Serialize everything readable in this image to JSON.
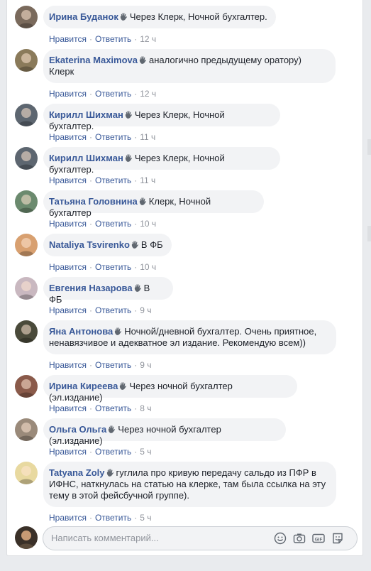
{
  "comments": [
    {
      "author": "Ирина Буданок",
      "text_lines": [
        "Через Клерк, Ночной бухгалтер."
      ],
      "time": "12 ч",
      "avatar_color": "#7a6a5c"
    },
    {
      "author": "Ekaterina Maximova",
      "text_lines": [
        "аналогично предыдущему оратору)",
        "Клерк"
      ],
      "time": "12 ч",
      "avatar_color": "#8a7a5a"
    },
    {
      "author": "Кирилл Шихман",
      "text_lines": [
        "Через Клерк, Ночной бухгалтер."
      ],
      "time": "11 ч",
      "avatar_color": "#5d6670"
    },
    {
      "author": "Кирилл Шихман",
      "text_lines": [
        "Через Клерк, Ночной бухгалтер."
      ],
      "time": "11 ч",
      "avatar_color": "#5d6670"
    },
    {
      "author": "Татьяна Головнина",
      "text_lines": [
        "Клерк, Ночной бухгалтер"
      ],
      "time": "10 ч",
      "avatar_color": "#6b8a6e"
    },
    {
      "author": "Nataliya Tsvirenko",
      "text_lines": [
        "В ФБ"
      ],
      "time": "10 ч",
      "avatar_color": "#d8a070"
    },
    {
      "author": "Евгения Назарова",
      "text_lines": [
        "В ФБ"
      ],
      "time": "9 ч",
      "avatar_color": "#c9b8c0"
    },
    {
      "author": "Яна Антонова",
      "text_lines": [
        "Ночной/дневной бухгалтер. Очень приятное,",
        "ненавязчивое и адекватное эл издание. Рекомендую всем))"
      ],
      "time": "9 ч",
      "avatar_color": "#4a4a3a"
    },
    {
      "author": "Ирина Киреева",
      "text_lines": [
        "Через ночной бухгалтер (эл.издание)"
      ],
      "time": "8 ч",
      "avatar_color": "#8a5a4a"
    },
    {
      "author": "Ольга Ольга",
      "text_lines": [
        "Через ночной бухгалтер (эл.издание)"
      ],
      "time": "5 ч",
      "avatar_color": "#9a8a7a"
    },
    {
      "author": "Tatyana Zoly",
      "text_lines": [
        "гуглила про кривую передачу сальдо из ПФР в",
        "ИФНС, наткнулась на статью на клерке, там была ссылка на эту",
        "тему в этой фейсбучной группе)."
      ],
      "time": "5 ч",
      "avatar_color": "#e8d9a0"
    }
  ],
  "actions": {
    "like": "Нравится",
    "reply": "Ответить",
    "dot": "·"
  },
  "composer": {
    "placeholder": "Написать комментарий...",
    "avatar_color": "#5a4a3a"
  },
  "colors": {
    "link": "#385898",
    "bubble": "#f2f3f5",
    "meta": "#90949c"
  },
  "icons": [
    "wave-icon",
    "emoji-icon",
    "camera-icon",
    "gif-icon",
    "sticker-icon"
  ]
}
